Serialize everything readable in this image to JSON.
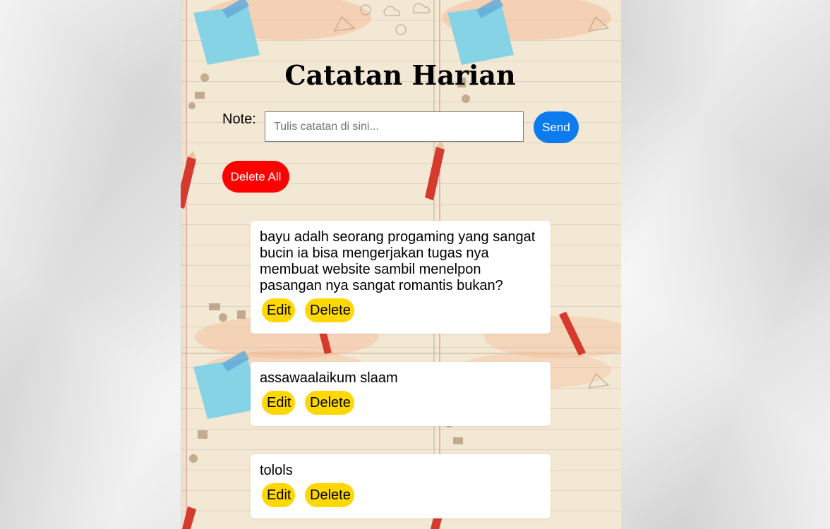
{
  "app": {
    "title": "Catatan Harian"
  },
  "form": {
    "label": "Note:",
    "input_value": "",
    "input_placeholder": "Tulis catatan di sini...",
    "send_label": "Send",
    "delete_all_label": "Delete All"
  },
  "notes": [
    {
      "text": "bayu adalh seorang progaming yang sangat bucin ia bisa mengerjakan tugas nya membuat website sambil menelpon pasangan nya sangat romantis bukan?",
      "edit_label": "Edit",
      "delete_label": "Delete"
    },
    {
      "text": "assawaalaikum slaam",
      "edit_label": "Edit",
      "delete_label": "Delete"
    },
    {
      "text": "tolols",
      "edit_label": "Edit",
      "delete_label": "Delete"
    }
  ],
  "colors": {
    "send_button": "#0d7bf0",
    "delete_all_button": "#ff0000",
    "note_action_button": "#ffd800",
    "note_card": "#ffffff",
    "page_background": "#f3e8d3"
  }
}
